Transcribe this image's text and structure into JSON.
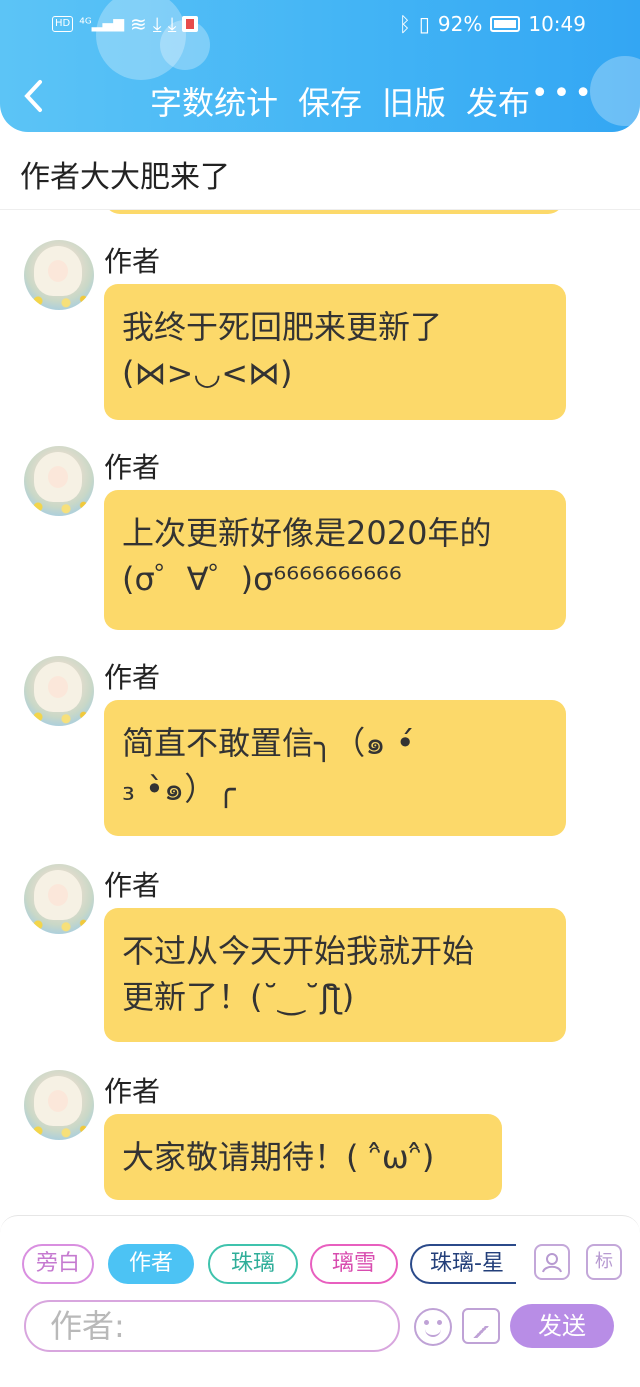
{
  "status_bar": {
    "left": "HD 4G",
    "battery": "92%",
    "time": "10:49"
  },
  "header": {
    "back_icon": "chevron-left-icon",
    "actions": [
      "字数统计",
      "保存",
      "旧版",
      "发布"
    ],
    "more_label": "•••"
  },
  "title": "作者大大肥来了",
  "messages": [
    {
      "author": "作者",
      "text": "我终于死回肥来更新了\n(⋈>◡<⋈)"
    },
    {
      "author": "作者",
      "text": "上次更新好像是2020年的\n(σ゜∀゜)σ⁶⁶⁶⁶⁶⁶⁶⁶⁶⁶"
    },
    {
      "author": "作者",
      "text": "简直不敢置信╮（๑ •́\n₃ •̀๑）╭"
    },
    {
      "author": "作者",
      "text": "不过从今天开始我就开始\n更新了！(˘‿˘ʃƪ)"
    },
    {
      "author": "作者",
      "text": "大家敬请期待！( ᵔ̂ωᵔ̂)"
    }
  ],
  "composer": {
    "roles": [
      "旁白",
      "作者",
      "珠璃",
      "璃雪",
      "珠璃-星"
    ],
    "selected_role": "作者",
    "icon_person": "person-card-icon",
    "icon_tag": "标",
    "placeholder": "作者:",
    "send_label": "发送"
  },
  "colors": {
    "header": "#41b3f5",
    "bubble": "#fcd96a",
    "send": "#b88de6"
  }
}
